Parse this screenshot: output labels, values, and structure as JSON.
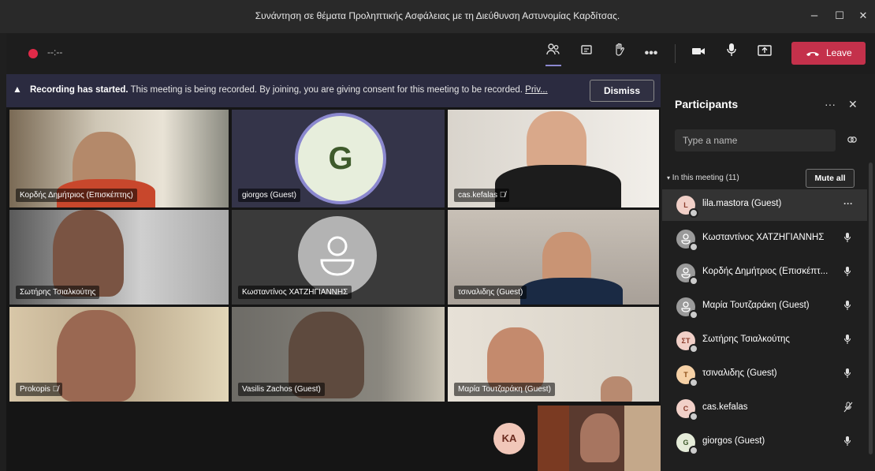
{
  "window": {
    "title": "Συνάντηση σε θέματα Προληπτικής Ασφάλειας με τη Διεύθυνση Αστυνομίας Καρδίτσας.",
    "minimize": "–",
    "maximize": "☐",
    "close": "✕"
  },
  "toolbar": {
    "timer": "--:--",
    "leave_label": "Leave",
    "icons": [
      "participants-icon",
      "chat-icon",
      "raise-hand-icon",
      "more-icon",
      "camera-icon",
      "mic-icon",
      "share-icon"
    ]
  },
  "banner": {
    "bold": "Recording has started.",
    "text": "This meeting is being recorded. By joining, you are giving consent for this meeting to be recorded.",
    "link": "Priv...",
    "dismiss": "Dismiss"
  },
  "tiles": [
    {
      "name": "Κορδής Δημήτριος (Επισκέπτης)"
    },
    {
      "name": "giorgos (Guest)",
      "initial": "G"
    },
    {
      "name": "cas.kefalas"
    },
    {
      "name": "Σωτήρης Τσιαλκούτης"
    },
    {
      "name": "Κωσταντίνος ΧΑΤΖΗΓΙΑΝΝΗΣ"
    },
    {
      "name": "τσιναλιδης (Guest)"
    },
    {
      "name": "Prokopis"
    },
    {
      "name": "Vasilis Zachos (Guest)"
    },
    {
      "name": "Μαρία Τουτζαράκη (Guest)"
    }
  ],
  "self": {
    "initials": "KA"
  },
  "panel": {
    "title": "Participants",
    "more": "···",
    "close": "✕",
    "search_placeholder": "Type a name",
    "section": "In this meeting (11)",
    "mute_all": "Mute all",
    "participants": [
      {
        "initials": "L",
        "name": "lila.mastora (Guest)",
        "color": "#f1d0c8",
        "text_color": "#8a3b2b",
        "action": "···"
      },
      {
        "initials": "",
        "name": "Κωσταντίνος ΧΑΤΖΗΓΙΑΝΝΗΣ",
        "color": "#9a9a9a",
        "text_color": "#fff",
        "action": "mic"
      },
      {
        "initials": "",
        "name": "Κορδής Δημήτριος (Επισκέπτ...",
        "color": "#9a9a9a",
        "text_color": "#fff",
        "action": "mic"
      },
      {
        "initials": "",
        "name": "Μαρία Τουτζαράκη (Guest)",
        "color": "#9a9a9a",
        "text_color": "#fff",
        "action": "mic"
      },
      {
        "initials": "ΣΤ",
        "name": "Σωτήρης Τσιαλκούτης",
        "color": "#f1d0c8",
        "text_color": "#8a3b2b",
        "action": "mic"
      },
      {
        "initials": "T",
        "name": "τσιναλιδης (Guest)",
        "color": "#f6d1a6",
        "text_color": "#8a4b14",
        "action": "mic"
      },
      {
        "initials": "C",
        "name": "cas.kefalas",
        "color": "#f1d0c8",
        "text_color": "#8a3b2b",
        "action": "mic-off"
      },
      {
        "initials": "G",
        "name": "giorgos (Guest)",
        "color": "#e5ecd9",
        "text_color": "#3e5a2b",
        "action": "mic"
      }
    ]
  }
}
